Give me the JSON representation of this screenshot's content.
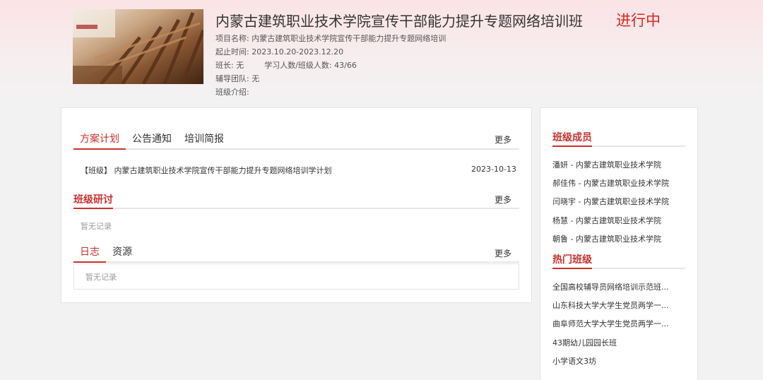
{
  "header": {
    "title": "内蒙古建筑职业技术学院宣传干部能力提升专题网络培训班",
    "status": "进行中",
    "project_name_label": "项目名称:",
    "project_name": "内蒙古建筑职业技术学院宣传干部能力提升专题网络培训",
    "period_label": "起止时间:",
    "period": "2023.10.20-2023.12.20",
    "monitor_label": "班长:",
    "monitor": "无",
    "count_label": "学习人数/班级人数:",
    "count": "43/66",
    "team_label": "辅导团队:",
    "team": "无",
    "intro_label": "班级介绍:",
    "intro": ""
  },
  "plan_section": {
    "tabs": [
      "方案计划",
      "公告通知",
      "培训简报"
    ],
    "more": "更多",
    "items": [
      {
        "title": "【班级】 内蒙古建筑职业技术学院宣传干部能力提升专题网络培训学计划",
        "date": "2023-10-13"
      }
    ]
  },
  "discussion_section": {
    "heading": "班级研讨",
    "more": "更多",
    "empty_text": "暂无记录"
  },
  "log_section": {
    "tabs": [
      "日志",
      "资源"
    ],
    "more": "更多",
    "empty_text": "暂无记录"
  },
  "sidebar": {
    "members_heading": "班级成员",
    "members": [
      "潘妍 - 内蒙古建筑职业技术学院",
      "郝佳伟 - 内蒙古建筑职业技术学院",
      "闫晓宇 - 内蒙古建筑职业技术学院",
      "杨慧 - 内蒙古建筑职业技术学院",
      "朝鲁 - 内蒙古建筑职业技术学院"
    ],
    "hot_heading": "热门班级",
    "hot_classes": [
      "全国高校辅导员网络培训示范班...",
      "山东科技大学大学生党员两学一...",
      "曲阜师范大学大学生党员两学一...",
      "43期幼儿园园长班",
      "小学语文3坊"
    ]
  },
  "colors": {
    "accent": "#c9302c",
    "status": "#d9261c",
    "banner_top": "#fbe3e6"
  }
}
